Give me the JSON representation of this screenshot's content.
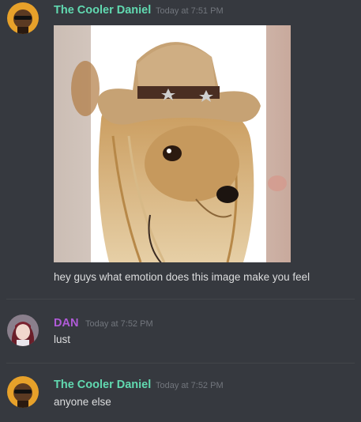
{
  "messages": [
    {
      "author": "The Cooler Daniel",
      "author_color": "#61d9b0",
      "timestamp": "Today at 7:51 PM",
      "avatar": "sunglasses-man-avatar",
      "attachment": "dog-in-cowboy-hat-image",
      "text": "hey guys what emotion does this image make you feel"
    },
    {
      "author": "DAN",
      "author_color": "#b05bd8",
      "timestamp": "Today at 7:52 PM",
      "avatar": "anime-girl-avatar",
      "text": "lust"
    },
    {
      "author": "The Cooler Daniel",
      "author_color": "#61d9b0",
      "timestamp": "Today at 7:52 PM",
      "avatar": "sunglasses-man-avatar",
      "text": "anyone else"
    }
  ]
}
